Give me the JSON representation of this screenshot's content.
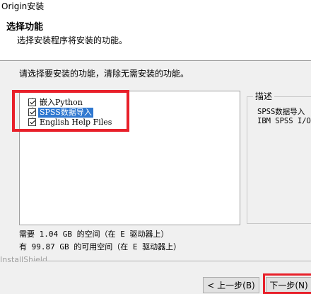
{
  "window": {
    "title": "Origin安装"
  },
  "header": {
    "title": "选择功能",
    "subtitle": "选择安装程序将安装的功能。"
  },
  "instruction": "请选择要安装的功能，清除无需安装的功能。",
  "features": [
    {
      "label": "嵌入Python",
      "checked": true,
      "selected": false
    },
    {
      "label": "SPSS数据导入",
      "checked": true,
      "selected": true
    },
    {
      "label": "English Help Files",
      "checked": true,
      "selected": false
    }
  ],
  "description": {
    "label": "描述",
    "line1": "SPSS数据导入",
    "line2": "IBM SPSS I/O链"
  },
  "space": {
    "required": "需要 1.04 GB 的空间（在 E 驱动器上）",
    "available": "有 99.87 GB 的可用空间（在 E 驱动器上）"
  },
  "brand": "InstallShield",
  "buttons": {
    "back": "< 上一步(B)",
    "next": "下一步(N)"
  },
  "colors": {
    "annotation_red": "#e8202a",
    "selection_blue": "#3078d0"
  }
}
